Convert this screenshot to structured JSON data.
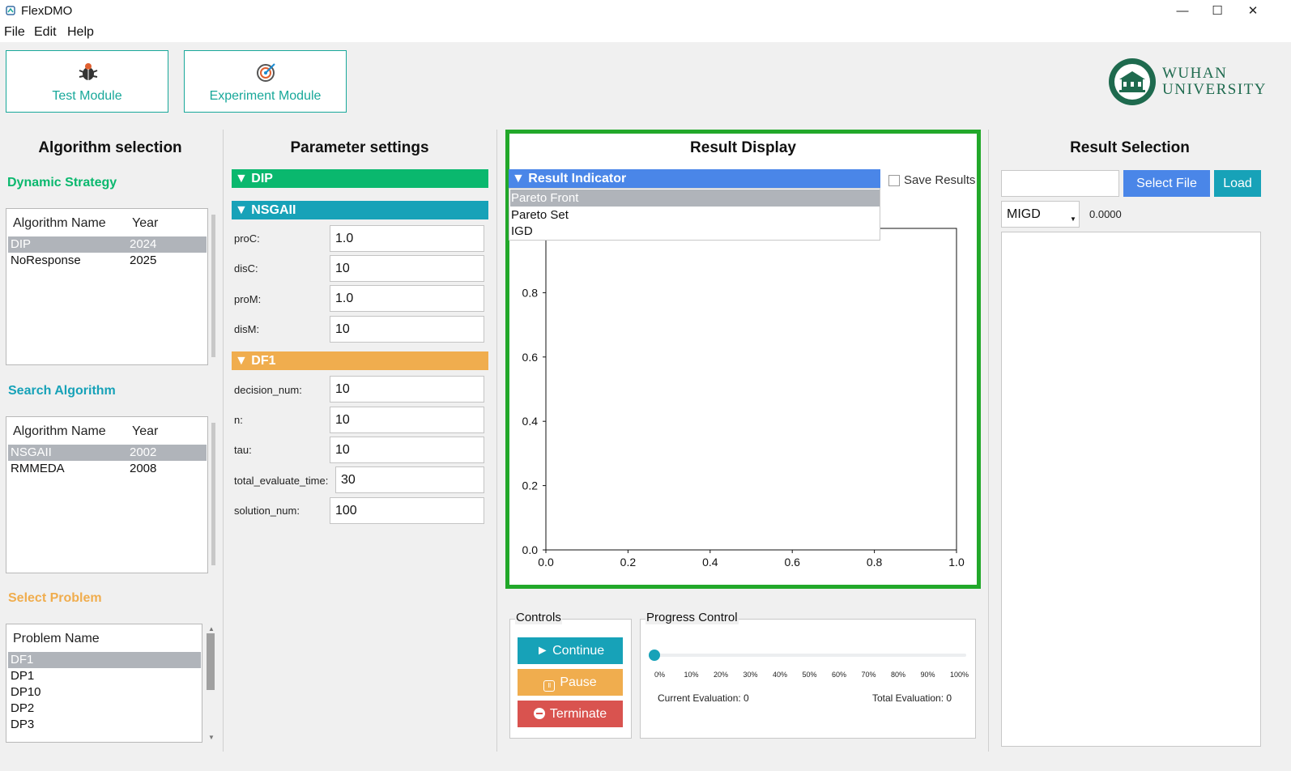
{
  "window": {
    "title": "FlexDMO",
    "minimize": "—",
    "maximize": "☐",
    "close": "✕"
  },
  "menu": {
    "file": "File",
    "edit": "Edit",
    "help": "Help"
  },
  "modules": {
    "test": "Test Module",
    "experiment": "Experiment Module"
  },
  "logo": {
    "line1": "WUHAN",
    "line2": "UNIVERSITY"
  },
  "algorithm": {
    "title": "Algorithm selection",
    "dynamic_strategy": {
      "title": "Dynamic Strategy",
      "col_name": "Algorithm Name",
      "col_year": "Year",
      "rows": [
        {
          "name": "DIP",
          "year": "2024"
        },
        {
          "name": "NoResponse",
          "year": "2025"
        }
      ]
    },
    "search": {
      "title": "Search Algorithm",
      "col_name": "Algorithm Name",
      "col_year": "Year",
      "rows": [
        {
          "name": "NSGAII",
          "year": "2002"
        },
        {
          "name": "RMMEDA",
          "year": "2008"
        }
      ]
    },
    "problem": {
      "title": "Select Problem",
      "col_name": "Problem Name",
      "rows": [
        "DF1",
        "DP1",
        "DP10",
        "DP2",
        "DP3"
      ]
    }
  },
  "params": {
    "title": "Parameter settings",
    "dip": {
      "label": "▼ DIP",
      "color": "#0ab86e"
    },
    "nsgaii": {
      "label": "▼ NSGAII",
      "color": "#17a2b8",
      "fields": [
        {
          "label": "proC:",
          "value": "1.0"
        },
        {
          "label": "disC:",
          "value": "10"
        },
        {
          "label": "proM:",
          "value": "1.0"
        },
        {
          "label": "disM:",
          "value": "10"
        }
      ]
    },
    "df1": {
      "label": "▼ DF1",
      "color": "#f0ad4e",
      "fields": [
        {
          "label": "decision_num:",
          "value": "10"
        },
        {
          "label": "n:",
          "value": "10"
        },
        {
          "label": "tau:",
          "value": "10"
        },
        {
          "label": "total_evaluate_time:",
          "value": "30"
        },
        {
          "label": "solution_num:",
          "value": "100"
        }
      ]
    }
  },
  "result": {
    "title": "Result Display",
    "indicator_label": "▼ Result Indicator",
    "indicator_color": "#4a86e8",
    "options": [
      "Pareto Front",
      "Pareto Set",
      "IGD"
    ],
    "save_results": "Save Results",
    "chart_data": {
      "type": "line",
      "xlim": [
        0,
        1.0
      ],
      "ylim": [
        0,
        1.0
      ],
      "xticks": [
        "0.0",
        "0.2",
        "0.4",
        "0.6",
        "0.8",
        "1.0"
      ],
      "yticks": [
        "0.0",
        "0.2",
        "0.4",
        "0.6",
        "0.8"
      ],
      "series": []
    }
  },
  "controls": {
    "title": "Controls",
    "continue": "► Continue",
    "pause": "Pause",
    "terminate": "Terminate"
  },
  "progress": {
    "title": "Progress Control",
    "value": 0,
    "ticks": [
      "0%",
      "10%",
      "20%",
      "30%",
      "40%",
      "50%",
      "60%",
      "70%",
      "80%",
      "90%",
      "100%"
    ],
    "current": "Current Evaluation: 0",
    "total": "Total Evaluation: 0"
  },
  "selection": {
    "title": "Result Selection",
    "file_input": "",
    "select_file": "Select File",
    "load": "Load",
    "metric": "MIGD",
    "metric_value": "0.0000"
  },
  "colors": {
    "accent_teal": "#18a89a",
    "primary_blue": "#4a86e8",
    "info": "#17a2b8",
    "warning": "#f0ad4e",
    "danger": "#d9534f",
    "highlight": "#22a82a"
  }
}
